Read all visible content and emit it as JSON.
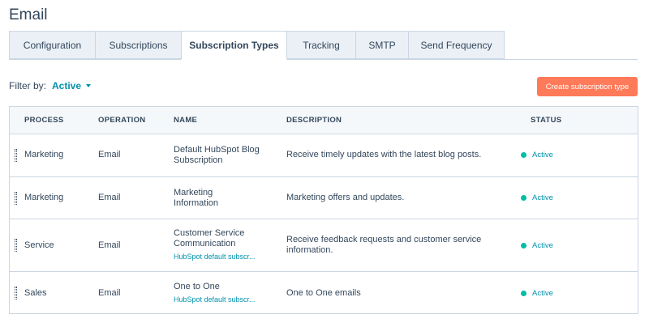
{
  "page_title": "Email",
  "tabs": [
    {
      "label": "Configuration",
      "active": false
    },
    {
      "label": "Subscriptions",
      "active": false
    },
    {
      "label": "Subscription Types",
      "active": true
    },
    {
      "label": "Tracking",
      "active": false
    },
    {
      "label": "SMTP",
      "active": false
    },
    {
      "label": "Send Frequency",
      "active": false
    }
  ],
  "filter": {
    "label": "Filter by:",
    "value": "Active"
  },
  "create_button_label": "Create subscription type",
  "table": {
    "columns": [
      "PROCESS",
      "OPERATION",
      "NAME",
      "DESCRIPTION",
      "STATUS"
    ],
    "rows": [
      {
        "process": "Marketing",
        "operation": "Email",
        "name_line1": "Default HubSpot Blog",
        "name_line2": "Subscription",
        "sublink": "",
        "description_line1": "Receive timely updates with the latest blog posts.",
        "description_line2": "",
        "status": "Active"
      },
      {
        "process": "Marketing",
        "operation": "Email",
        "name_line1": "Marketing",
        "name_line2": "Information",
        "sublink": "",
        "description_line1": "Marketing offers and updates.",
        "description_line2": "",
        "status": "Active"
      },
      {
        "process": "Service",
        "operation": "Email",
        "name_line1": "Customer Service",
        "name_line2": "Communication",
        "sublink": "HubSpot default subscr...",
        "description_line1": "Receive feedback requests and customer service",
        "description_line2": "information.",
        "status": "Active"
      },
      {
        "process": "Sales",
        "operation": "Email",
        "name_line1": "One to One",
        "name_line2": "",
        "sublink": "HubSpot default subscr...",
        "description_line1": "One to One emails",
        "description_line2": "",
        "status": "Active"
      }
    ]
  },
  "colors": {
    "accent": "#0091ae",
    "button": "#ff7a59",
    "status_dot": "#00bda5",
    "text": "#33475b",
    "border": "#cbd6e2"
  },
  "icons": {
    "handle": "drag-handle-icon",
    "caret": "caret-down-icon",
    "status": "status-dot-icon"
  }
}
